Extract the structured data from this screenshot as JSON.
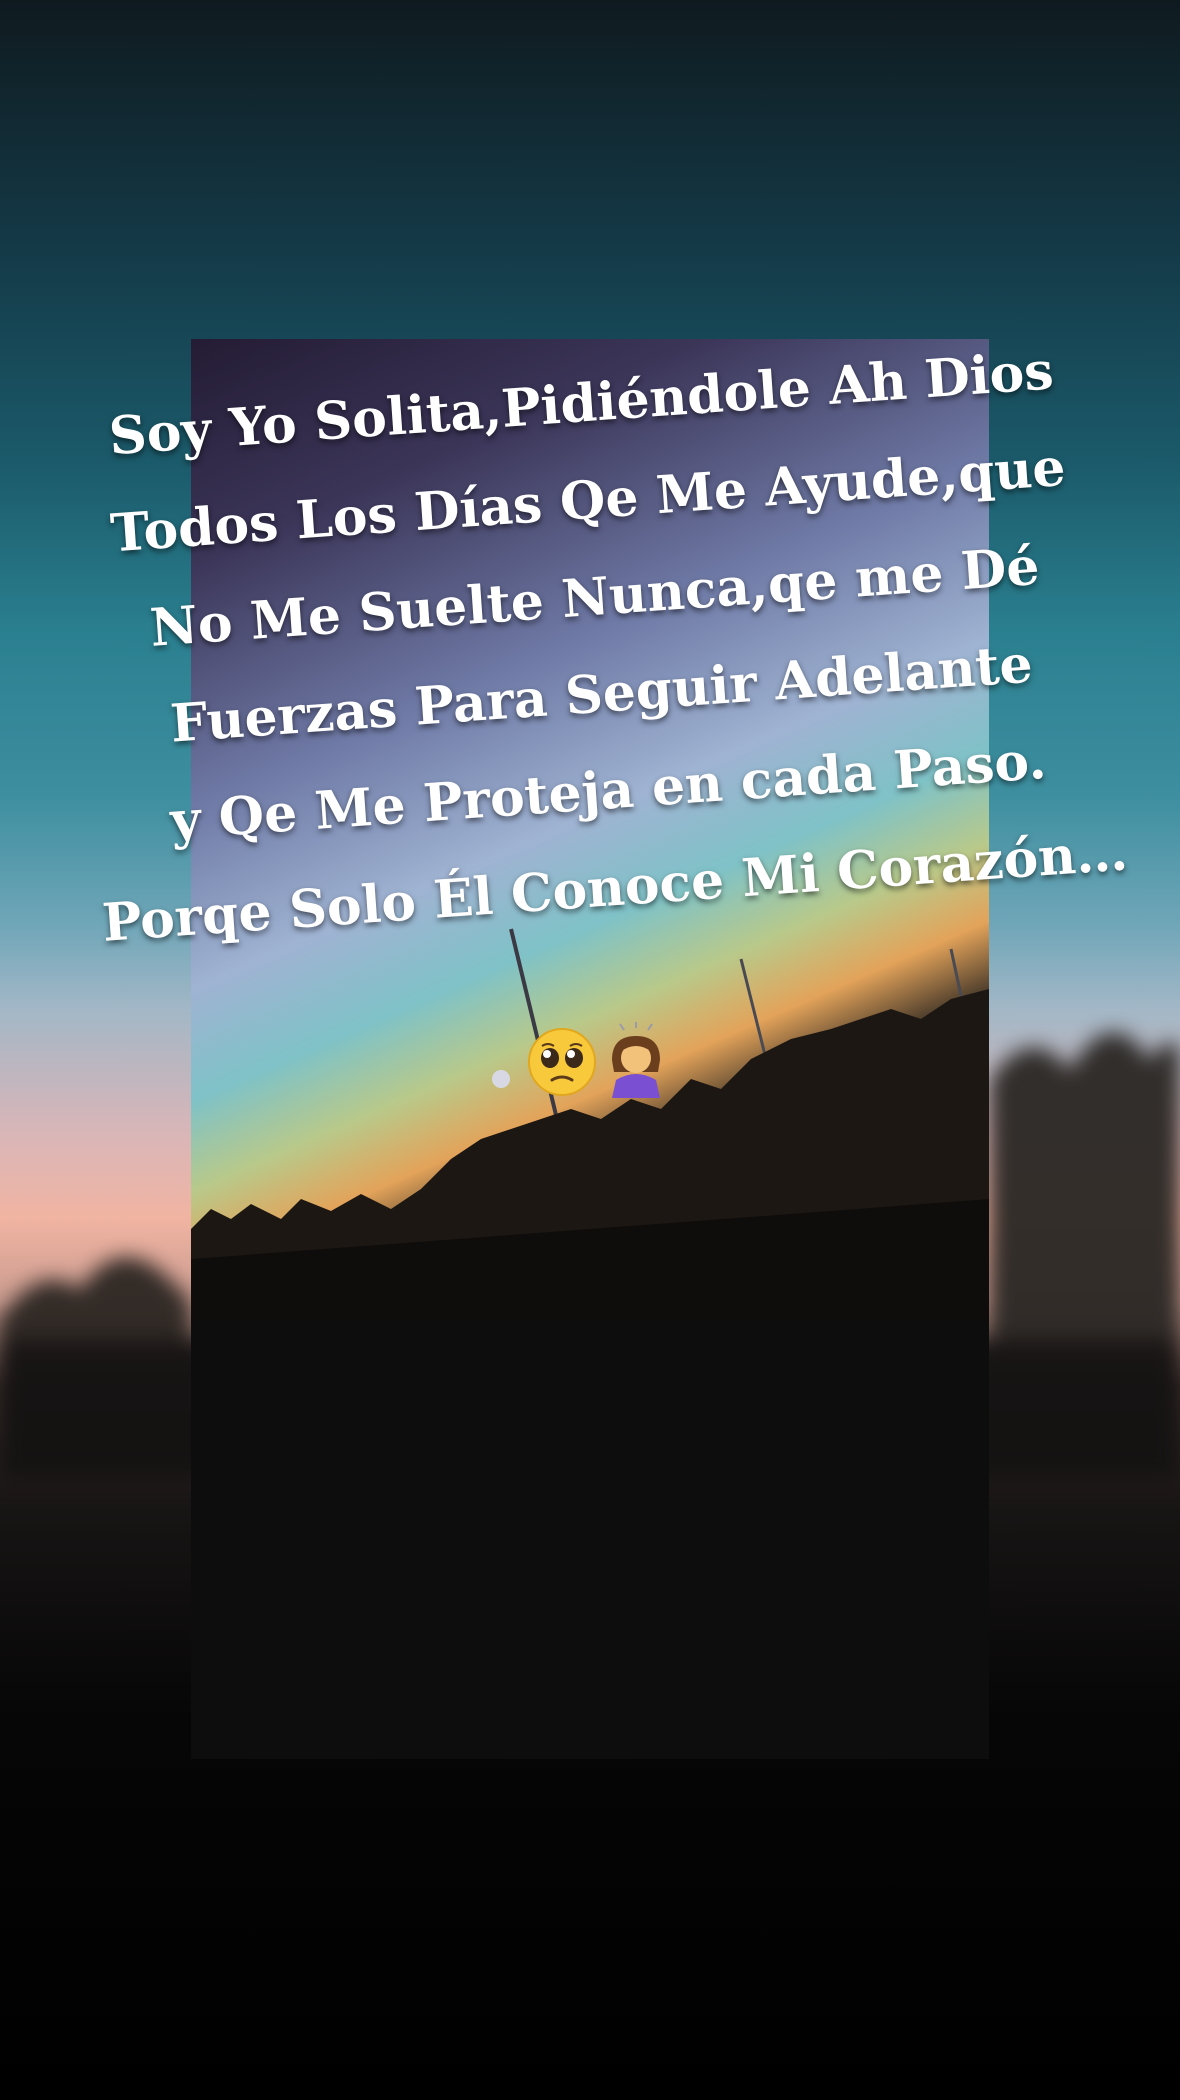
{
  "quote": {
    "lines": [
      "Soy Yo Solita,Pidiéndole Ah Dios",
      "Todos Los Días Qe Me Ayude,que",
      "No Me Suelte Nunca,qe me Dé",
      "Fuerzas Para Seguir Adelante",
      "y Qe Me Proteja en cada Paso.",
      "Porqe Solo Él Conoce Mi Corazón…"
    ]
  },
  "emojis": [
    "pleading-face-icon",
    "person-bowing-girl-icon"
  ],
  "colors": {
    "text": "#ffffff",
    "sky_top": "#143a48",
    "sky_mid": "#2a7f8f",
    "sunset": "#f1b4a2",
    "card_bg": "#0d0d0d"
  }
}
